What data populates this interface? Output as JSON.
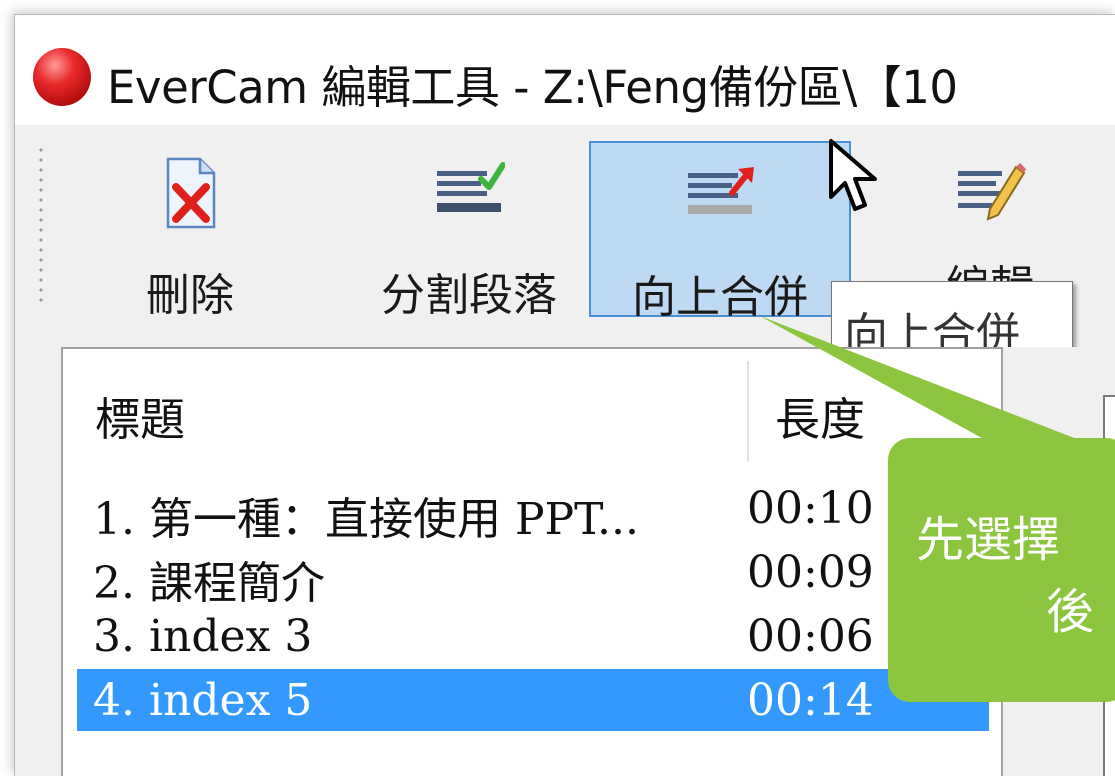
{
  "window": {
    "title": "EverCam 編輯工具 - Z:\\Feng備份區\\【10"
  },
  "toolbar": {
    "buttons": [
      {
        "label": "刪除",
        "icon": "delete-document-icon"
      },
      {
        "label": "分割段落",
        "icon": "split-paragraph-icon"
      },
      {
        "label": "向上合併",
        "icon": "merge-up-icon",
        "active": true
      },
      {
        "label": "編輯",
        "icon": "edit-pencil-icon"
      }
    ]
  },
  "tooltip": {
    "text": "向上合併"
  },
  "list": {
    "columns": {
      "title": "標題",
      "length": "長度"
    },
    "rows": [
      {
        "title": "1. 第一種：直接使用 PPT...",
        "length": "00:10",
        "selected": false
      },
      {
        "title": "2. 課程簡介",
        "length": "00:09",
        "selected": false
      },
      {
        "title": "3. index 3",
        "length": "00:06",
        "selected": false
      },
      {
        "title": "4. index 5",
        "length": "00:14",
        "selected": true
      }
    ]
  },
  "callout": {
    "line1": "先選擇",
    "line2": "後",
    "color": "#8cc63f"
  },
  "colors": {
    "selection": "#3399ff",
    "active_button_bg": "#bdd9f3",
    "active_button_border": "#4a90d6"
  }
}
